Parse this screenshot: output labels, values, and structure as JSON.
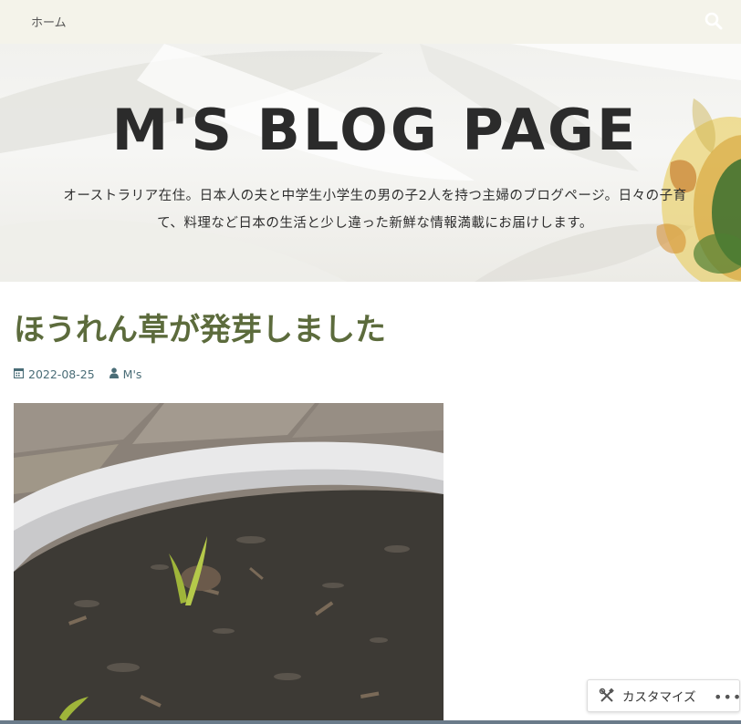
{
  "nav": {
    "home_label": "ホーム",
    "search_icon": "search-icon"
  },
  "header": {
    "site_title": "M'S BLOG PAGE",
    "description_line1": "オーストラリア在住。日本人の夫と中学生小学生の男の子2人を持つ主婦のブログページ。日々の子育",
    "description_line2": "て、料理など日本の生活と少し違った新鮮な情報満載にお届けします。"
  },
  "post": {
    "title": "ほうれん草が発芽しました",
    "date": "2022-08-25",
    "author": "M's",
    "date_icon": "calendar-icon",
    "author_icon": "user-icon"
  },
  "customize": {
    "label": "カスタマイズ",
    "icon": "tools-icon",
    "more_label": "•••"
  },
  "colors": {
    "nav_bg": "#f4f3ea",
    "title_color": "#5c6b3c",
    "meta_color": "#4a6d77"
  }
}
